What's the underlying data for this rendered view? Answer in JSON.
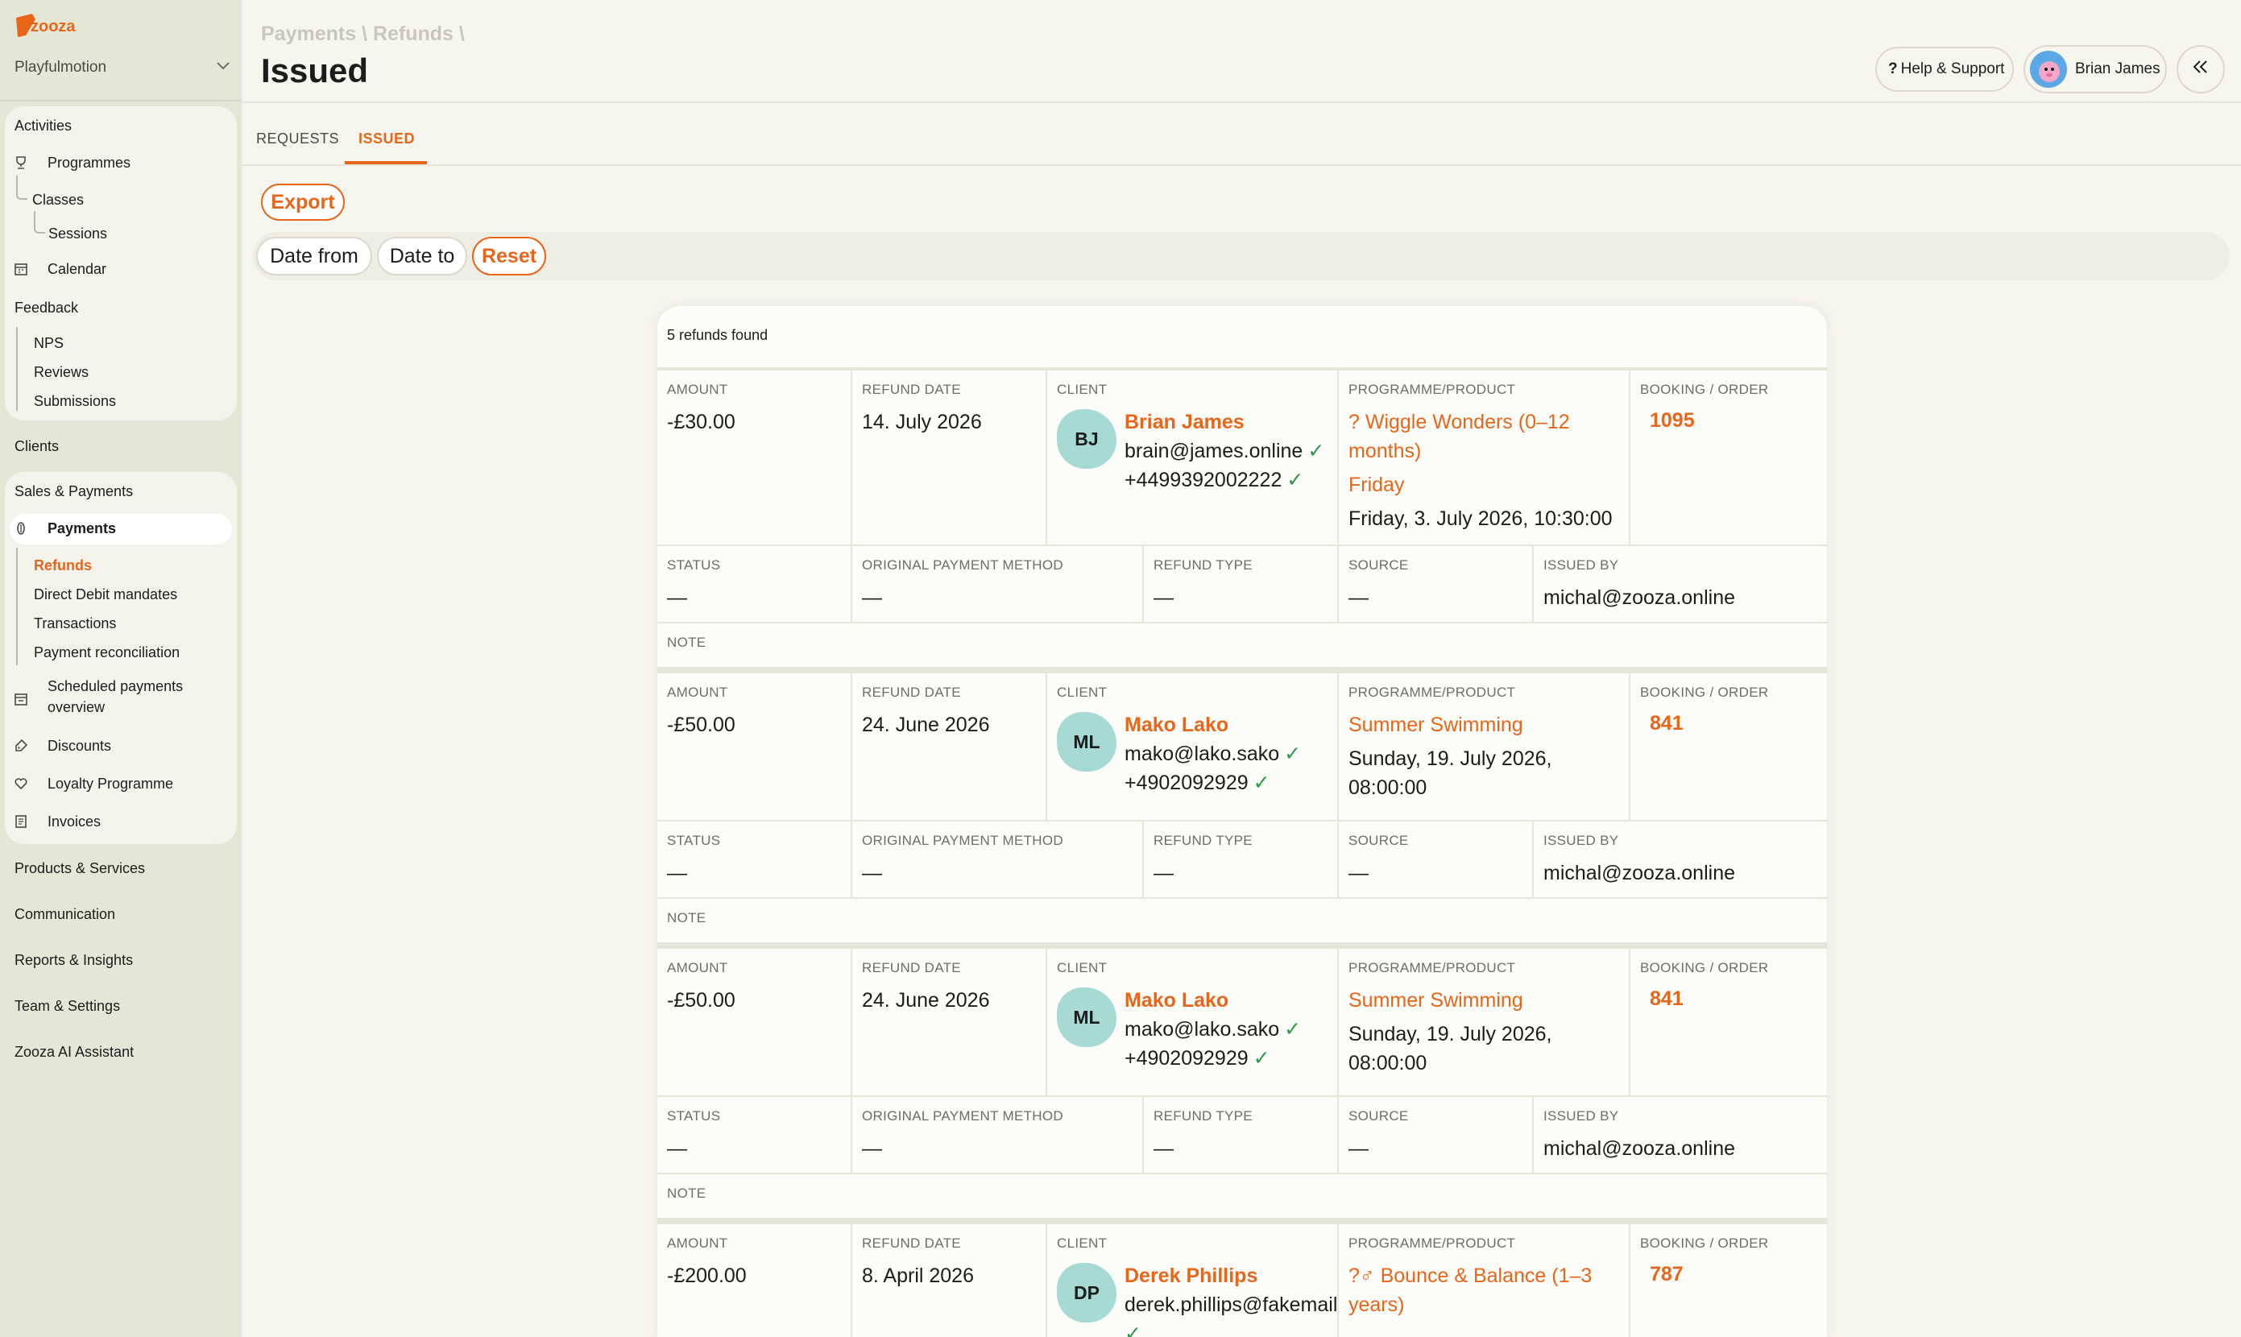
{
  "app": {
    "logo_text": "zooza",
    "organization": "Playfulmotion"
  },
  "sidebar": {
    "activities": "Activities",
    "programmes": "Programmes",
    "classes": "Classes",
    "sessions": "Sessions",
    "calendar": "Calendar",
    "feedback": "Feedback",
    "nps": "NPS",
    "reviews": "Reviews",
    "submissions": "Submissions",
    "clients": "Clients",
    "sales_payments": "Sales & Payments",
    "payments": "Payments",
    "refunds": "Refunds",
    "direct_debit": "Direct Debit mandates",
    "transactions": "Transactions",
    "reconciliation": "Payment reconciliation",
    "scheduled_1": "Scheduled payments",
    "scheduled_2": "overview",
    "discounts": "Discounts",
    "loyalty": "Loyalty Programme",
    "invoices": "Invoices",
    "products": "Products & Services",
    "communication": "Communication",
    "reports": "Reports & Insights",
    "team": "Team & Settings",
    "ai": "Zooza AI Assistant"
  },
  "header": {
    "breadcrumb": "Payments \\ Refunds \\",
    "title": "Issued",
    "help": "Help & Support",
    "user": "Brian James"
  },
  "tabs": {
    "requests": "REQUESTS",
    "issued": "ISSUED"
  },
  "toolbar": {
    "export": "Export",
    "date_from": "Date from",
    "date_to": "Date to",
    "reset": "Reset"
  },
  "results": {
    "count_text": "5 refunds found"
  },
  "labels": {
    "amount": "AMOUNT",
    "refund_date": "REFUND DATE",
    "client": "CLIENT",
    "programme": "PROGRAMME/PRODUCT",
    "booking": "BOOKING / ORDER",
    "status": "STATUS",
    "original_method": "ORIGINAL PAYMENT METHOD",
    "refund_type": "REFUND TYPE",
    "source": "SOURCE",
    "issued_by": "ISSUED BY",
    "note": "NOTE"
  },
  "refunds": [
    {
      "amount": "-£30.00",
      "date": "14. July 2026",
      "initials": "BJ",
      "client_name": "Brian James",
      "client_email": "brain@james.online",
      "client_phone": "+4499392002222",
      "programme_line1": "? Wiggle Wonders (0–12",
      "programme_line2": "months)",
      "programme_day": "Friday",
      "programme_datetime": "Friday, 3. July 2026, 10:30:00",
      "booking": "1095",
      "status": "—",
      "original_method": "—",
      "refund_type": "—",
      "source": "—",
      "issued_by": "michal@zooza.online"
    },
    {
      "amount": "-£50.00",
      "date": "24. June 2026",
      "initials": "ML",
      "client_name": "Mako Lako",
      "client_email": "mako@lako.sako",
      "client_phone": "+4902092929",
      "programme_line1": "Summer Swimming",
      "programme_dt1": "Sunday, 19. July 2026,",
      "programme_dt2": "08:00:00",
      "booking": "841",
      "status": "—",
      "original_method": "—",
      "refund_type": "—",
      "source": "—",
      "issued_by": "michal@zooza.online"
    },
    {
      "amount": "-£50.00",
      "date": "24. June 2026",
      "initials": "ML",
      "client_name": "Mako Lako",
      "client_email": "mako@lako.sako",
      "client_phone": "+4902092929",
      "programme_line1": "Summer Swimming",
      "programme_dt1": "Sunday, 19. July 2026,",
      "programme_dt2": "08:00:00",
      "booking": "841",
      "status": "—",
      "original_method": "—",
      "refund_type": "—",
      "source": "—",
      "issued_by": "michal@zooza.online"
    },
    {
      "amount": "-£200.00",
      "date": "8. April 2026",
      "initials": "DP",
      "client_name": "Derek Phillips",
      "client_email": "derek.phillips@fakemail.",
      "programme_line1": "?♂ Bounce & Balance (1–3",
      "programme_line2": "years)",
      "booking": "787"
    }
  ],
  "colors": {
    "accent": "#e8651a",
    "sidebar_bg": "#e6e6d6",
    "page_bg": "#f7f6ee",
    "avatar": "#a8dad5",
    "verified": "#2e9a4a"
  }
}
